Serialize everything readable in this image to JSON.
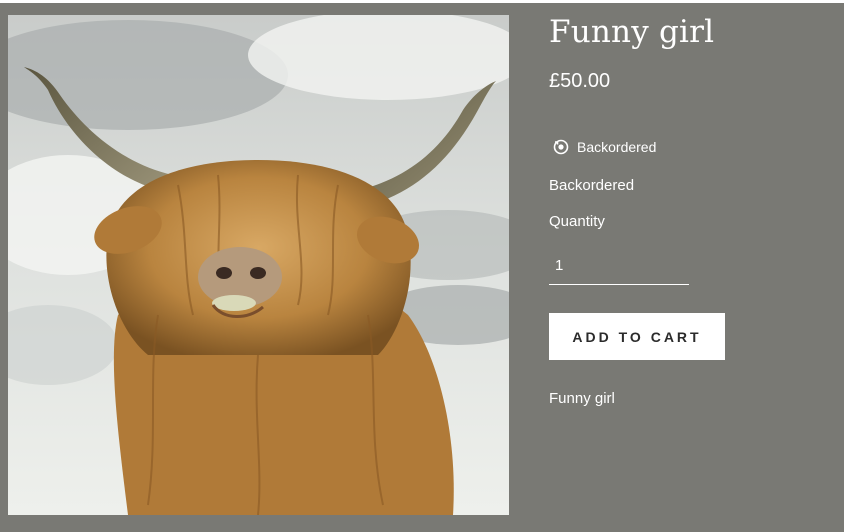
{
  "product": {
    "title": "Funny girl",
    "price": "£50.00",
    "stock_badge": "Backordered",
    "stock_status": "Backordered",
    "quantity_label": "Quantity",
    "quantity_value": "1",
    "add_to_cart_label": "ADD TO CART",
    "description": "Funny girl",
    "image_alt": "Highland cow sticking out its tongue",
    "stock_icon": "backorder-icon"
  },
  "theme": {
    "background": "#797974",
    "text": "#ffffff",
    "button_bg": "#ffffff",
    "button_text": "#2b2b2b"
  }
}
